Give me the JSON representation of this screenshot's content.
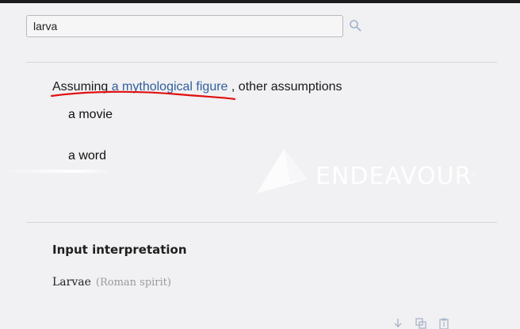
{
  "search": {
    "value": "larva"
  },
  "assumption": {
    "prefix": "Assuming",
    "selected": "a mythological figure",
    "suffix": ", other assumptions",
    "alternatives": [
      "a movie",
      "a word"
    ]
  },
  "watermark_text": "ENDEAVOUROS",
  "section": {
    "title": "Input interpretation",
    "term": "Larvae",
    "qualifier": "(Roman spirit)"
  },
  "colors": {
    "link": "#2f5f9e",
    "annotation_red": "#e01010",
    "background": "#f1f0f2"
  },
  "icons": [
    "search-icon",
    "download-icon",
    "copy-icon",
    "clipboard-icon"
  ]
}
